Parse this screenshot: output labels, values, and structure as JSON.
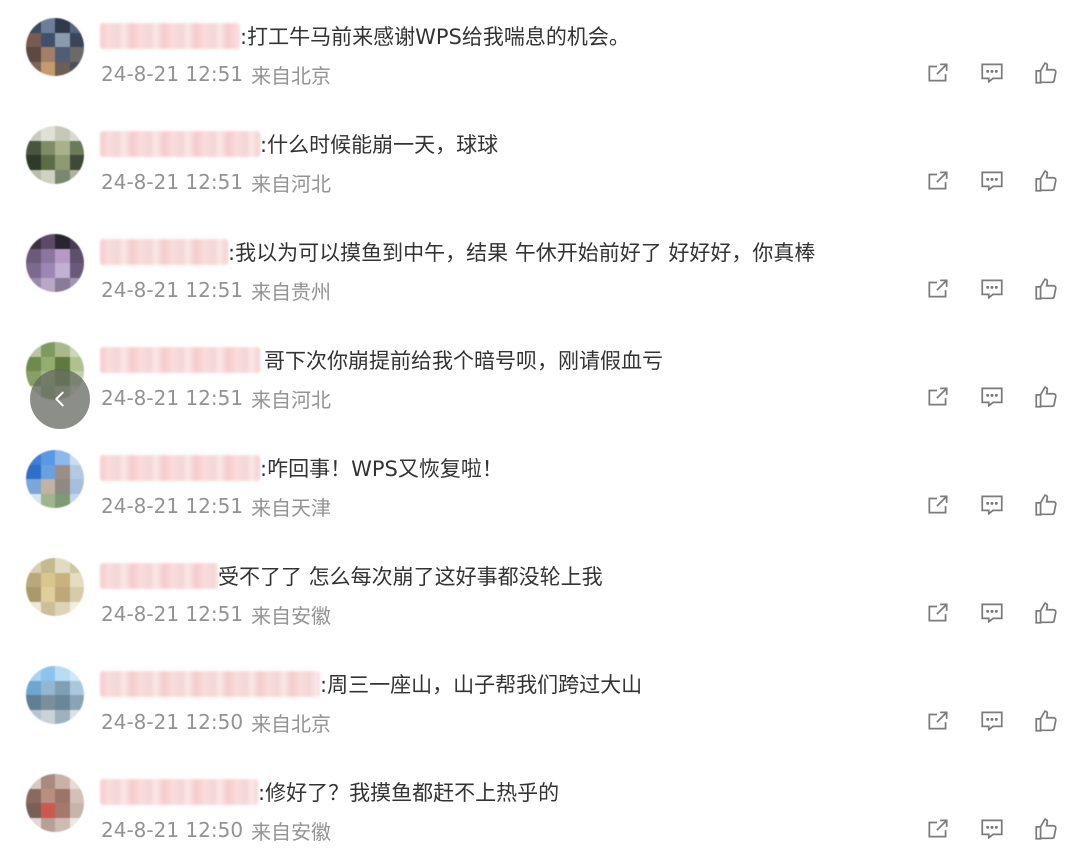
{
  "colors": {
    "text": "#333333",
    "meta": "#939393",
    "icon": "#7b7b7b",
    "name_blur": "#f6c9c9"
  },
  "icons": [
    "share-icon",
    "comment-icon",
    "like-icon",
    "chevron-left-icon"
  ],
  "comments": [
    {
      "text": ":打工牛马前来感谢WPS给我喘息的机会。",
      "time": "24-8-21 12:51",
      "location": "来自北京"
    },
    {
      "text": ":什么时候能崩一天，球球",
      "time": "24-8-21 12:51",
      "location": "来自河北"
    },
    {
      "text": ":我以为可以摸鱼到中午，结果 午休开始前好了  好好好，你真棒",
      "time": "24-8-21 12:51",
      "location": "来自贵州"
    },
    {
      "text": "哥下次你崩提前给我个暗号呗，刚请假血亏",
      "time": "24-8-21 12:51",
      "location": "来自河北"
    },
    {
      "text": ":咋回事！WPS又恢复啦！",
      "time": "24-8-21 12:51",
      "location": "来自天津"
    },
    {
      "text": "受不了了 怎么每次崩了这好事都没轮上我",
      "time": "24-8-21 12:51",
      "location": "来自安徽"
    },
    {
      "text": ":周三一座山，山子帮我们跨过大山",
      "time": "24-8-21 12:50",
      "location": "来自北京"
    },
    {
      "text": ":修好了？我摸鱼都赶不上热乎的",
      "time": "24-8-21 12:50",
      "location": "来自安徽"
    }
  ]
}
